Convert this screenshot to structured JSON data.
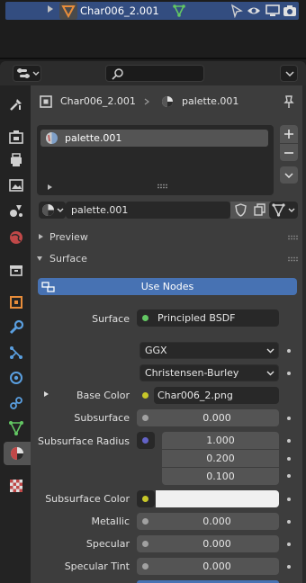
{
  "outliner": {
    "object_name": "Char006_2.001"
  },
  "header": {
    "search_placeholder": ""
  },
  "breadcrumb": {
    "object": "Char006_2.001",
    "material": "palette.001"
  },
  "slots": {
    "items": [
      {
        "name": "palette.001"
      }
    ]
  },
  "material_selector": {
    "name": "palette.001"
  },
  "panels": {
    "preview": "Preview",
    "surface": "Surface"
  },
  "use_nodes_label": "Use Nodes",
  "surface_row": {
    "label": "Surface",
    "value": "Principled BSDF"
  },
  "distribution": "GGX",
  "subsurface_method": "Christensen-Burley",
  "props": {
    "base_color": {
      "label": "Base Color",
      "value": "Char006_2.png"
    },
    "subsurface": {
      "label": "Subsurface",
      "value": "0.000"
    },
    "subsurface_radius": {
      "label": "Subsurface Radius",
      "values": [
        "1.000",
        "0.200",
        "0.100"
      ]
    },
    "subsurface_color": {
      "label": "Subsurface Color",
      "value": "#f0f0f0"
    },
    "metallic": {
      "label": "Metallic",
      "value": "0.000"
    },
    "specular": {
      "label": "Specular",
      "value": "0.000"
    },
    "specular_tint": {
      "label": "Specular Tint",
      "value": "0.000"
    }
  },
  "colors": {
    "accent_blue": "#4772b3",
    "selection_blue": "#334d80",
    "socket_green": "#63c763",
    "socket_yellow": "#c7c729",
    "socket_gray": "#a1a1a1",
    "socket_purple": "#6363c7",
    "object_orange": "#e88d3a"
  }
}
